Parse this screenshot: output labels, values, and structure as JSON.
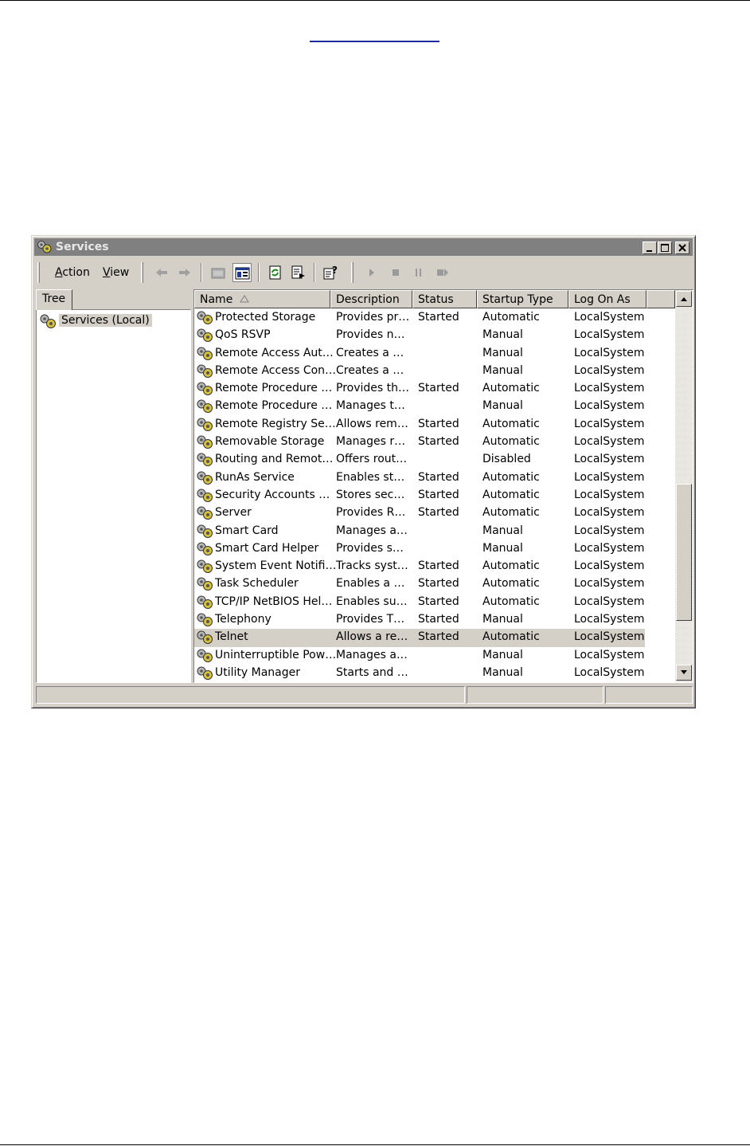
{
  "window": {
    "title": "Services",
    "icon": "gears-icon",
    "controls": [
      "minimize-icon",
      "maximize-icon",
      "close-icon"
    ]
  },
  "menu": {
    "action": {
      "pre": "",
      "key": "A",
      "post": "ction"
    },
    "view": {
      "pre": "",
      "key": "V",
      "post": "iew"
    }
  },
  "toolbar": {
    "buttons": [
      "back-arrow-icon",
      "forward-arrow-icon",
      "up-folder-icon",
      "show-hide-tree-icon",
      "refresh-icon",
      "export-list-icon",
      "properties-help-icon",
      "play-icon",
      "stop-icon",
      "pause-icon",
      "restart-icon"
    ]
  },
  "tree": {
    "tab_label": "Tree",
    "root_label": "Services (Local)"
  },
  "list": {
    "columns": [
      "Name",
      "Description",
      "Status",
      "Startup Type",
      "Log On As"
    ],
    "rows": [
      [
        "Protected Storage",
        "Provides pr…",
        "Started",
        "Automatic",
        "LocalSystem"
      ],
      [
        "QoS RSVP",
        "Provides n…",
        "",
        "Manual",
        "LocalSystem"
      ],
      [
        "Remote Access Aut…",
        "Creates a …",
        "",
        "Manual",
        "LocalSystem"
      ],
      [
        "Remote Access Con…",
        "Creates a …",
        "",
        "Manual",
        "LocalSystem"
      ],
      [
        "Remote Procedure …",
        "Provides th…",
        "Started",
        "Automatic",
        "LocalSystem"
      ],
      [
        "Remote Procedure …",
        "Manages t…",
        "",
        "Manual",
        "LocalSystem"
      ],
      [
        "Remote Registry Se…",
        "Allows rem…",
        "Started",
        "Automatic",
        "LocalSystem"
      ],
      [
        "Removable Storage",
        "Manages r…",
        "Started",
        "Automatic",
        "LocalSystem"
      ],
      [
        "Routing and Remot…",
        "Offers rout…",
        "",
        "Disabled",
        "LocalSystem"
      ],
      [
        "RunAs Service",
        "Enables st…",
        "Started",
        "Automatic",
        "LocalSystem"
      ],
      [
        "Security Accounts …",
        "Stores sec…",
        "Started",
        "Automatic",
        "LocalSystem"
      ],
      [
        "Server",
        "Provides R…",
        "Started",
        "Automatic",
        "LocalSystem"
      ],
      [
        "Smart Card",
        "Manages a…",
        "",
        "Manual",
        "LocalSystem"
      ],
      [
        "Smart Card Helper",
        "Provides s…",
        "",
        "Manual",
        "LocalSystem"
      ],
      [
        "System Event Notifi…",
        "Tracks syst…",
        "Started",
        "Automatic",
        "LocalSystem"
      ],
      [
        "Task Scheduler",
        "Enables a …",
        "Started",
        "Automatic",
        "LocalSystem"
      ],
      [
        "TCP/IP NetBIOS Hel…",
        "Enables su…",
        "Started",
        "Automatic",
        "LocalSystem"
      ],
      [
        "Telephony",
        "Provides T…",
        "Started",
        "Manual",
        "LocalSystem"
      ],
      [
        "Telnet",
        "Allows a re…",
        "Started",
        "Automatic",
        "LocalSystem"
      ],
      [
        "Uninterruptible Pow…",
        "Manages a…",
        "",
        "Manual",
        "LocalSystem"
      ],
      [
        "Utility Manager",
        "Starts and …",
        "",
        "Manual",
        "LocalSystem"
      ]
    ],
    "selected_row": 18,
    "row_icon": "gears-icon"
  },
  "colors": {
    "titlebar": "#808080",
    "face": "#d4d0c8",
    "selection": "#d4d0c8",
    "doc_link_underline": "#1f2a9a"
  }
}
